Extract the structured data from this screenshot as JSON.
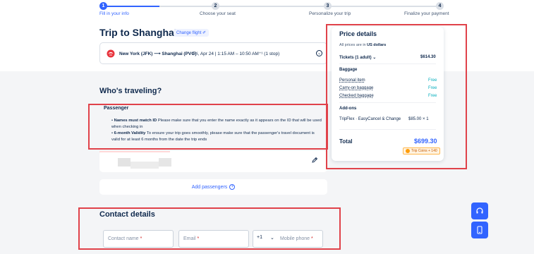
{
  "stepper": {
    "steps": [
      {
        "number": "1",
        "label": "Fill in your info"
      },
      {
        "number": "2",
        "label": "Choose your seat"
      },
      {
        "number": "3",
        "label": "Personalize your trip"
      },
      {
        "number": "4",
        "label": "Finalize your payment"
      }
    ]
  },
  "trip": {
    "title": "Trip to Shanghai",
    "change_flight": "Change flight ✐",
    "route": "New York (JFK) ⟶ Shanghai (PVG)",
    "time": "Fri, Apr 24  |  1:15 AM – 10:50 AM⁺¹  (1 stop)"
  },
  "travelers": {
    "title": "Who's traveling?",
    "passenger_label": "Passenger",
    "notice_1_bold": "Names must match ID",
    "notice_1_text": " Please make sure that you enter the name exactly as it appears on the ID that will be used when checking in",
    "notice_2_bold": "6-month Validity",
    "notice_2_text": " To ensure your trip goes smoothly, please make sure that the passenger's travel document is valid for at least 6 months from the date the trip ends",
    "add_passengers": "Add passengers"
  },
  "contact": {
    "title": "Contact details",
    "name_placeholder": "Contact name",
    "email_placeholder": "Email",
    "country_code": "+1",
    "phone_placeholder": "Mobile phone",
    "required_mark": "*"
  },
  "price": {
    "title": "Price details",
    "subtitle_prefix": "All prices are in ",
    "currency": "US dollars",
    "tickets_label": "Tickets  (1 adult)  ⌄",
    "tickets_value": "$614.30",
    "baggage_head": "Baggage",
    "baggage": [
      {
        "label": "Personal item",
        "value": "Free"
      },
      {
        "label": "Carry-on baggage",
        "value": "Free"
      },
      {
        "label": "Checked baggage",
        "value": "Free"
      }
    ],
    "addons_head": "Add-ons",
    "addon_label": "TripFlex · EasyCancel & Change",
    "addon_value": "$85.00 × 1",
    "total_label": "Total",
    "total_value": "$699.30",
    "trip_coins": "Trip Coins + 140"
  },
  "colors": {
    "accent": "#3264ff",
    "free": "#06aebd",
    "annotation": "#e0424a"
  }
}
